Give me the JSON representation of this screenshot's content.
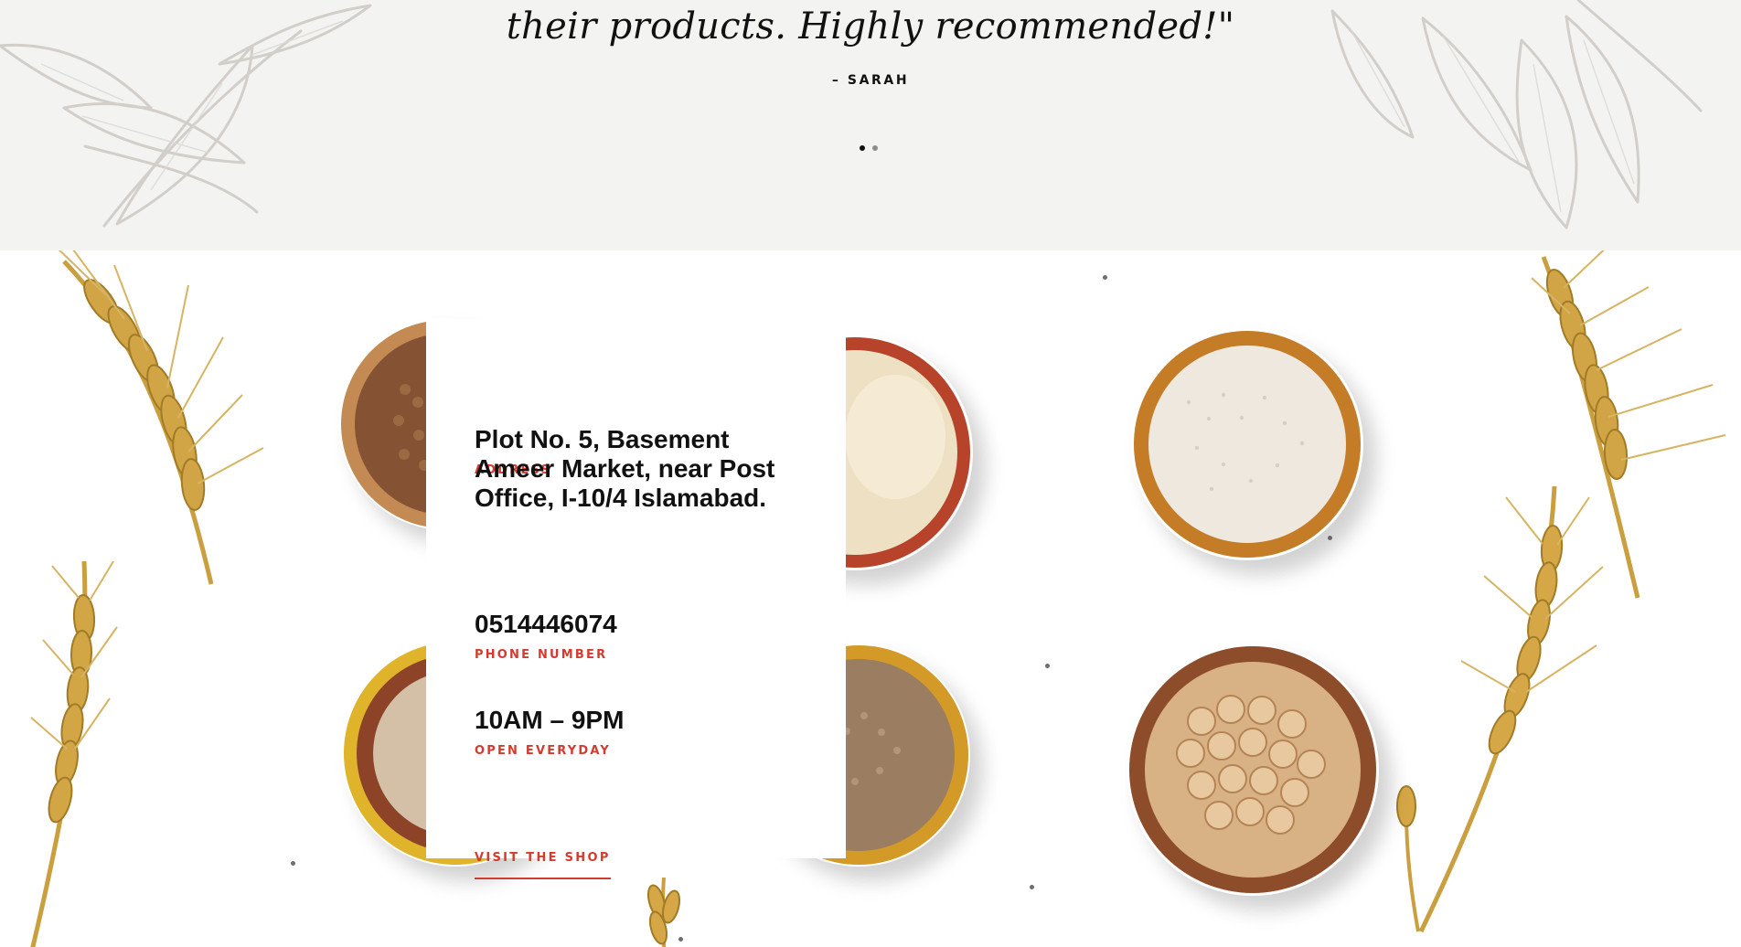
{
  "testimonial": {
    "quote": "their products. Highly recommended!\"",
    "author": "– SARAH",
    "pagination": {
      "dots": [
        {
          "label": "slide-1",
          "active": true
        },
        {
          "label": "slide-2",
          "active": false
        }
      ]
    }
  },
  "contact": {
    "address_label": "ADDRESS",
    "address_value": "Plot No. 5, Basement Ameer Market, near Post Office, I-10/4 Islamabad.",
    "phone_label": "PHONE NUMBER",
    "phone_value": "0514446074",
    "hours_label": "OPEN EVERYDAY",
    "hours_value": "10AM – 9PM",
    "shop_link": "VISIT THE SHOP"
  },
  "visuals": {
    "accent_color": "#d43b2f",
    "band_color": "#f3f3f1",
    "decorations": [
      "leaf-sketch-icon",
      "wheat-stalk-icon",
      "lentils-bowl-icon",
      "flour-bowl-icon",
      "quinoa-bowl-icon",
      "chickpeas-bowl-icon"
    ]
  }
}
